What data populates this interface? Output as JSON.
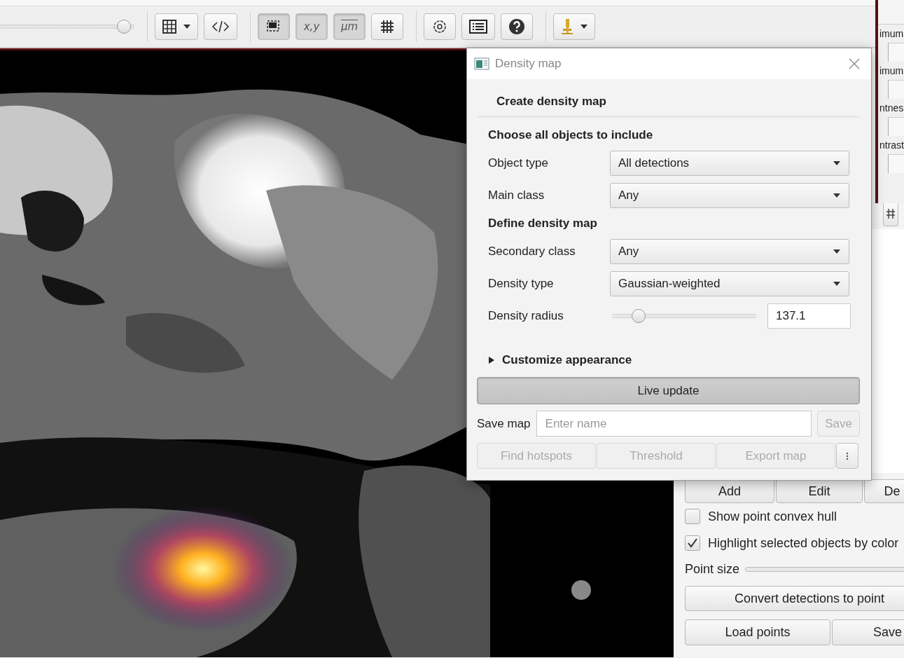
{
  "toolbar": {
    "slider": {
      "level": 0.97
    },
    "buttons": [
      {
        "kind": "table-menu",
        "selected": false
      },
      {
        "kind": "code",
        "selected": false
      },
      {
        "kind": "selection",
        "selected": true
      },
      {
        "kind": "text",
        "label": "x,y",
        "selected": true
      },
      {
        "kind": "text",
        "label": "µm",
        "selected": true
      },
      {
        "kind": "grid",
        "selected": false
      },
      {
        "kind": "settings",
        "selected": false
      },
      {
        "kind": "list",
        "selected": false
      },
      {
        "kind": "help",
        "selected": false
      },
      {
        "kind": "microscope-menu",
        "selected": false
      }
    ]
  },
  "back_window": {
    "labels": [
      "imum",
      "imum",
      "ntnes",
      "ntrast"
    ]
  },
  "side_panel": {
    "point_buttons": [
      "Add",
      "Edit",
      "De"
    ],
    "options": [
      {
        "label": "Show point convex hull",
        "checked": false
      },
      {
        "label": "Highlight selected objects by color",
        "checked": true
      }
    ],
    "point_size": {
      "label": "Point size"
    },
    "convert_button": "Convert detections to point",
    "file_buttons": [
      "Load points",
      "Save"
    ]
  },
  "density_dialog": {
    "title": "Density map",
    "header": "Create density map",
    "groups": [
      {
        "heading": "Choose all objects to include",
        "rows": [
          {
            "kind": "combo",
            "label": "Object type",
            "value": "All detections"
          },
          {
            "kind": "combo",
            "label": "Main class",
            "value": "Any"
          }
        ]
      },
      {
        "heading": "Define density map",
        "rows": [
          {
            "kind": "combo",
            "label": "Secondary class",
            "value": "Any"
          },
          {
            "kind": "combo",
            "label": "Density type",
            "value": "Gaussian-weighted"
          },
          {
            "kind": "slider",
            "label": "Density radius",
            "level": 0.15,
            "value": "137.1"
          }
        ]
      }
    ],
    "appearance": {
      "label": "Customize appearance",
      "expanded": false
    },
    "live_update": {
      "label": "Live update",
      "selected": true
    },
    "save_map": {
      "label": "Save map",
      "placeholder": "Enter name",
      "button": {
        "label": "Save",
        "disabled": true
      }
    },
    "actions": [
      {
        "kind": "text",
        "label": "Find hotspots",
        "disabled": true
      },
      {
        "kind": "text",
        "label": "Threshold",
        "disabled": true
      },
      {
        "kind": "text",
        "label": "Export map",
        "disabled": true
      },
      {
        "kind": "more",
        "disabled": false
      }
    ]
  }
}
